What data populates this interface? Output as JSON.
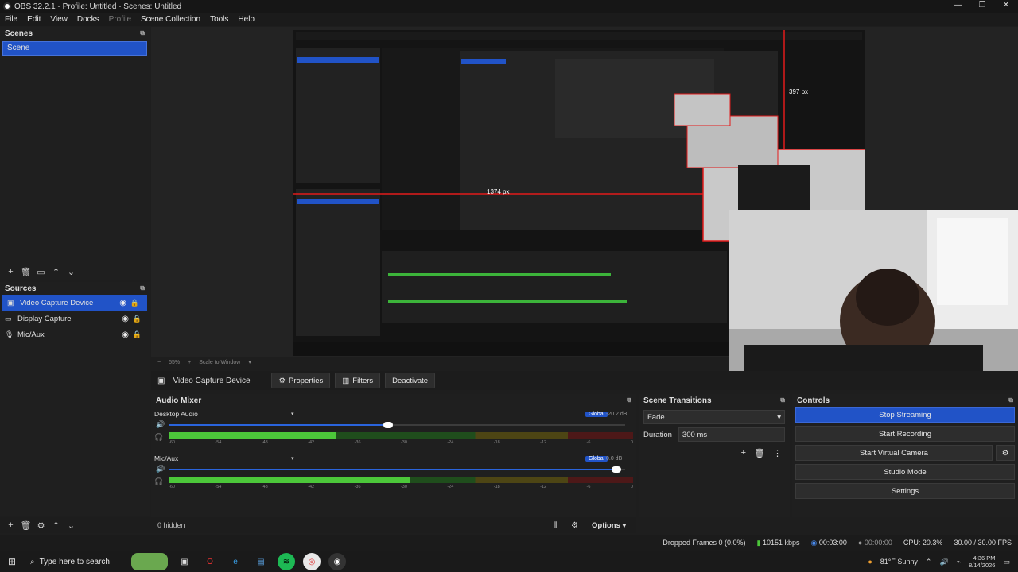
{
  "window": {
    "title": "OBS 32.2.1 - Profile: Untitled - Scenes: Untitled"
  },
  "menu": [
    {
      "label": "File",
      "enabled": true
    },
    {
      "label": "Edit",
      "enabled": true
    },
    {
      "label": "View",
      "enabled": true
    },
    {
      "label": "Docks",
      "enabled": true
    },
    {
      "label": "Profile",
      "enabled": false
    },
    {
      "label": "Scene Collection",
      "enabled": true
    },
    {
      "label": "Tools",
      "enabled": true
    },
    {
      "label": "Help",
      "enabled": true
    }
  ],
  "scenes": {
    "title": "Scenes",
    "items": [
      "Scene"
    ]
  },
  "sources": {
    "title": "Sources",
    "items": [
      {
        "label": "Video Capture Device",
        "icon": "camera-icon",
        "selected": true
      },
      {
        "label": "Display Capture",
        "icon": "monitor-icon",
        "selected": false
      },
      {
        "label": "Mic/Aux",
        "icon": "mic-icon",
        "selected": false
      }
    ]
  },
  "preview": {
    "label_397": "397 px",
    "label_1374": "1374 px"
  },
  "zoombar": {
    "zoom": "55%",
    "scale": "Scale to Window"
  },
  "context": {
    "source_name": "Video Capture Device",
    "properties": "Properties",
    "filters": "Filters",
    "deactivate": "Deactivate"
  },
  "mixer": {
    "title": "Audio Mixer",
    "ticks": [
      "-60",
      "-54",
      "-48",
      "-42",
      "-36",
      "-30",
      "-24",
      "-18",
      "-12",
      "-6",
      "0"
    ],
    "channels": [
      {
        "name": "Desktop Audio",
        "global": "Global",
        "db": "-20.2 dB",
        "level": 0.36,
        "fader": 0.48
      },
      {
        "name": "Mic/Aux",
        "global": "Global",
        "db": "0.0 dB",
        "level": 0.52,
        "fader": 0.98
      }
    ],
    "hidden": "0 hidden",
    "options": "Options"
  },
  "transitions": {
    "title": "Scene Transitions",
    "selected": "Fade",
    "duration_label": "Duration",
    "duration_value": "300 ms"
  },
  "controls": {
    "title": "Controls",
    "stop_streaming": "Stop Streaming",
    "start_recording": "Start Recording",
    "start_virtual_camera": "Start Virtual Camera",
    "studio_mode": "Studio Mode",
    "settings": "Settings"
  },
  "status": {
    "dropped": "Dropped Frames 0 (0.0%)",
    "bitrate": "10151 kbps",
    "stream_time": "00:03:00",
    "rec_time": "00:00:00",
    "cpu": "CPU: 20.3%",
    "fps": "30.00 / 30.00 FPS"
  },
  "taskbar": {
    "search_placeholder": "Type here to search",
    "weather": "81°F  Sunny",
    "time": "4:36 PM",
    "date": "8/14/2026"
  },
  "colors": {
    "accent": "#2153c7",
    "meter_green": "#4cc73a",
    "meter_yellow": "#c9b21f",
    "meter_red": "#c72a2a"
  }
}
